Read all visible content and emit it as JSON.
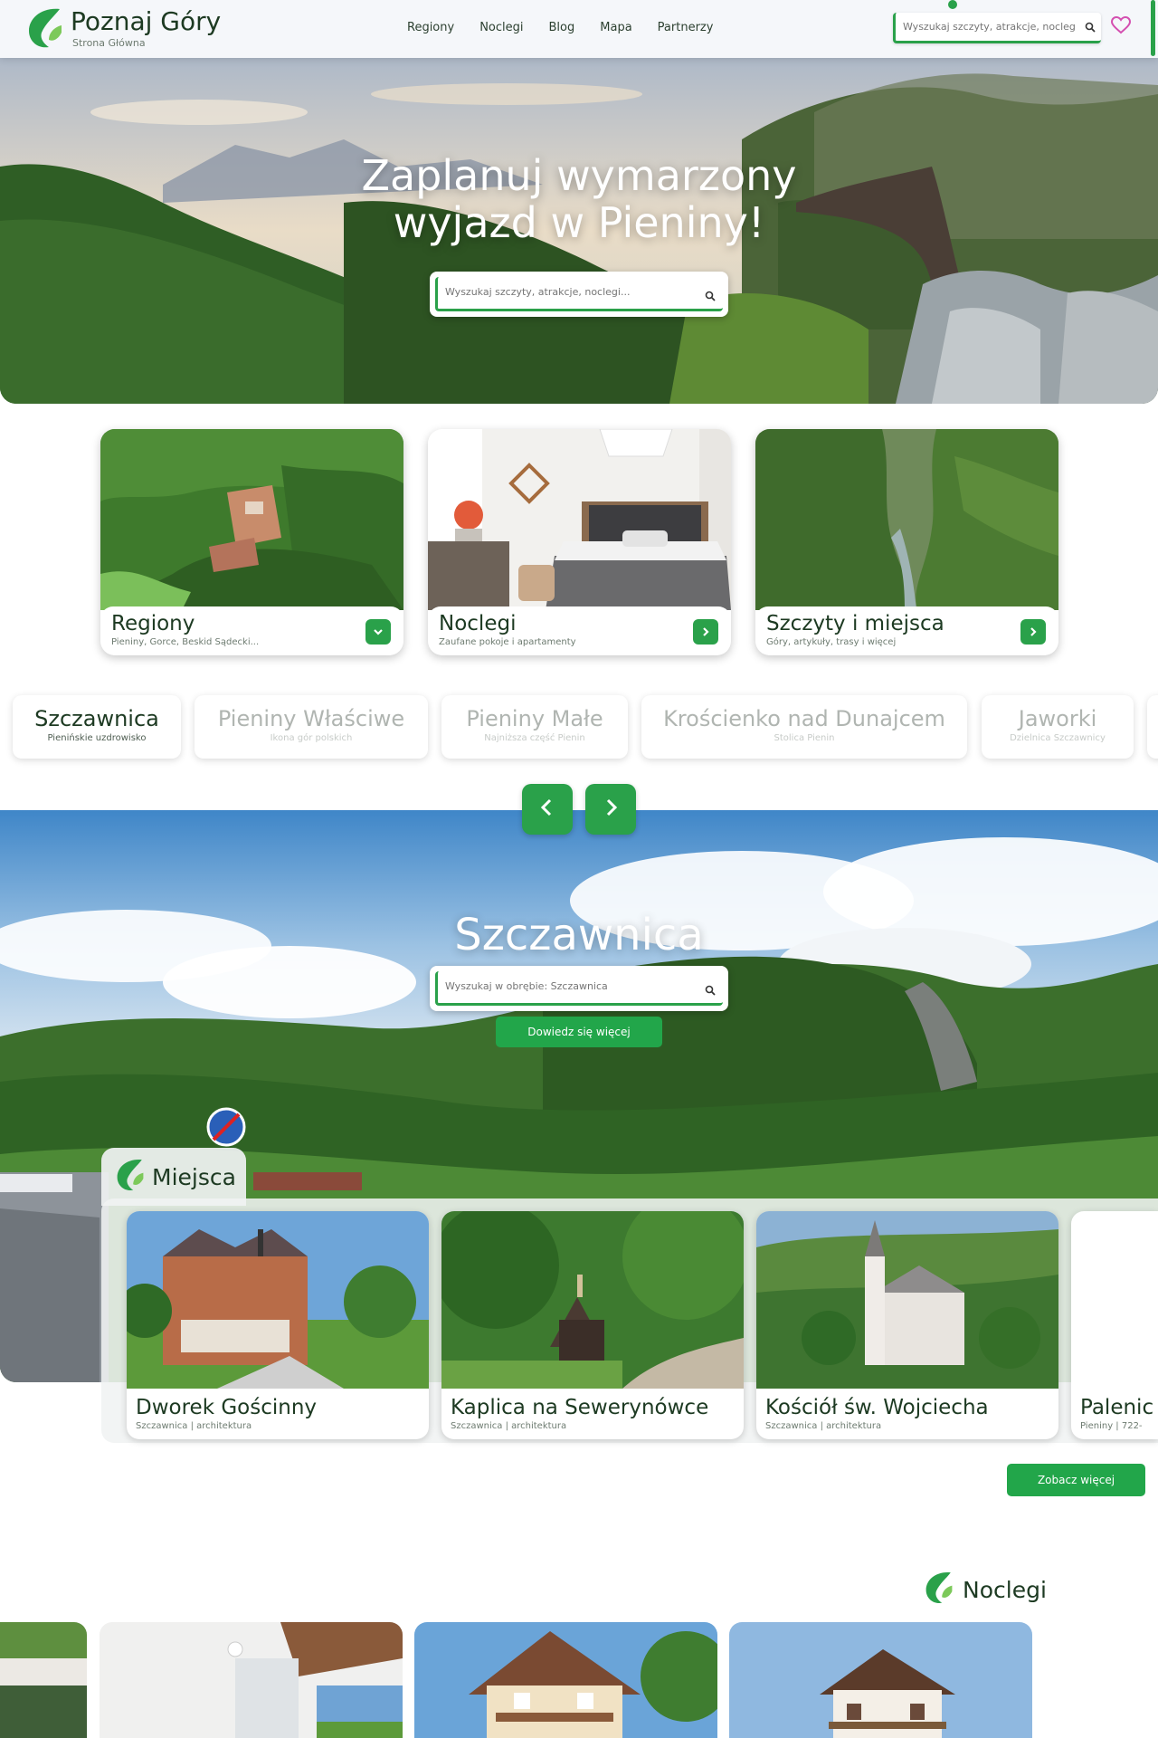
{
  "header": {
    "logo_title": "Poznaj Góry",
    "logo_subtitle": "Strona Główna",
    "nav": [
      "Regiony",
      "Noclegi",
      "Blog",
      "Mapa",
      "Partnerzy"
    ],
    "search_placeholder": "Wyszukaj szczyty, atrakcje, noclegi...",
    "icons": [
      "search-icon",
      "heart-icon"
    ]
  },
  "hero": {
    "title_line1": "Zaplanuj wymarzony",
    "title_line2": "wyjazd w Pieniny!",
    "search_placeholder": "Wyszukaj szczyty, atrakcje, noclegi..."
  },
  "categories": [
    {
      "title": "Regiony",
      "subtitle": "Pieniny, Gorce, Beskid Sądecki...",
      "icon": "chevron-down-icon"
    },
    {
      "title": "Noclegi",
      "subtitle": "Zaufane pokoje i apartamenty",
      "icon": "chevron-right-icon"
    },
    {
      "title": "Szczyty i miejsca",
      "subtitle": "Góry, artykuły, trasy i więcej",
      "icon": "chevron-right-icon"
    }
  ],
  "region_tabs": [
    {
      "title": "Szczawnica",
      "subtitle": "Pienińskie uzdrowisko",
      "active": true
    },
    {
      "title": "Pieniny Właściwe",
      "subtitle": "Ikona gór polskich",
      "active": false
    },
    {
      "title": "Pieniny Małe",
      "subtitle": "Najniższa część Pienin",
      "active": false
    },
    {
      "title": "Krościenko nad Dunajcem",
      "subtitle": "Stolica Pienin",
      "active": false
    },
    {
      "title": "Jaworki",
      "subtitle": "Dzielnica Szczawnicy",
      "active": false
    }
  ],
  "carousel": {
    "prev_icon": "chevron-left-icon",
    "next_icon": "chevron-right-icon"
  },
  "town": {
    "title": "Szczawnica",
    "search_placeholder": "Wyszukaj w obrębie: Szczawnica",
    "more_label": "Dowiedz się więcej"
  },
  "places": {
    "heading": "Miejsca",
    "items": [
      {
        "title": "Dworek Gościnny",
        "subtitle": "Szczawnica | architektura"
      },
      {
        "title": "Kaplica na Sewerynówce",
        "subtitle": "Szczawnica | architektura"
      },
      {
        "title": "Kościół św. Wojciecha",
        "subtitle": "Szczawnica | architektura"
      },
      {
        "title": "Palenic",
        "subtitle": "Pieniny | 722-"
      }
    ],
    "see_more_label": "Zobacz więcej"
  },
  "stays": {
    "heading": "Noclegi"
  },
  "colors": {
    "accent": "#22a64a",
    "dark_text": "#1d3a22",
    "muted_text": "#6d7b70"
  }
}
